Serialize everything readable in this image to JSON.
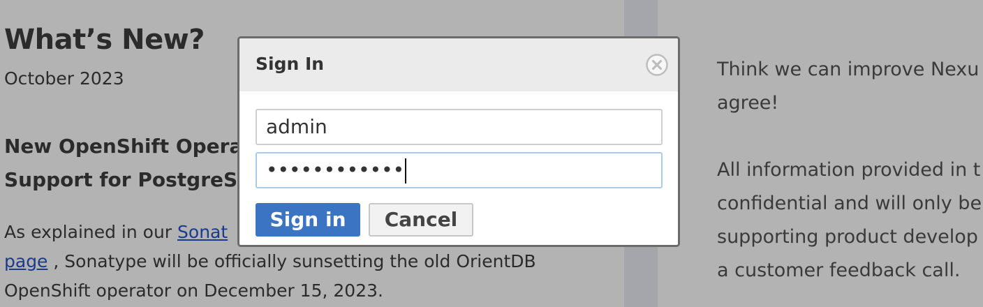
{
  "background": {
    "news_title": "What’s New?",
    "news_date": "October 2023",
    "news_heading_line1": "New OpenShift Opera",
    "news_heading_line2": "Support for PostgreS",
    "body_prefix": "As explained in our ",
    "body_link1": "Sonat",
    "body_link2": "page",
    "body_line2_rest": " , Sonatype will be officially sunsetting the old OrientDB",
    "body_line3": "OpenShift operator on December 15, 2023.",
    "right_p1_line1": "Think we can improve Nexu",
    "right_p1_line2": "agree!",
    "right_p2_line1": "All information provided in t",
    "right_p2_line2": "confidential and will only be",
    "right_p2_line3": "supporting product develop",
    "right_p2_line4": "a customer feedback call."
  },
  "modal": {
    "title": "Sign In",
    "username_value": "admin",
    "password_masked": "••••••••••••",
    "signin_label": "Sign in",
    "cancel_label": "Cancel"
  },
  "colors": {
    "overlay": "#b3b3b3",
    "primary_button": "#3a74c2",
    "focus_border": "#a9cbe6"
  },
  "icons": {
    "close": "close-icon"
  }
}
